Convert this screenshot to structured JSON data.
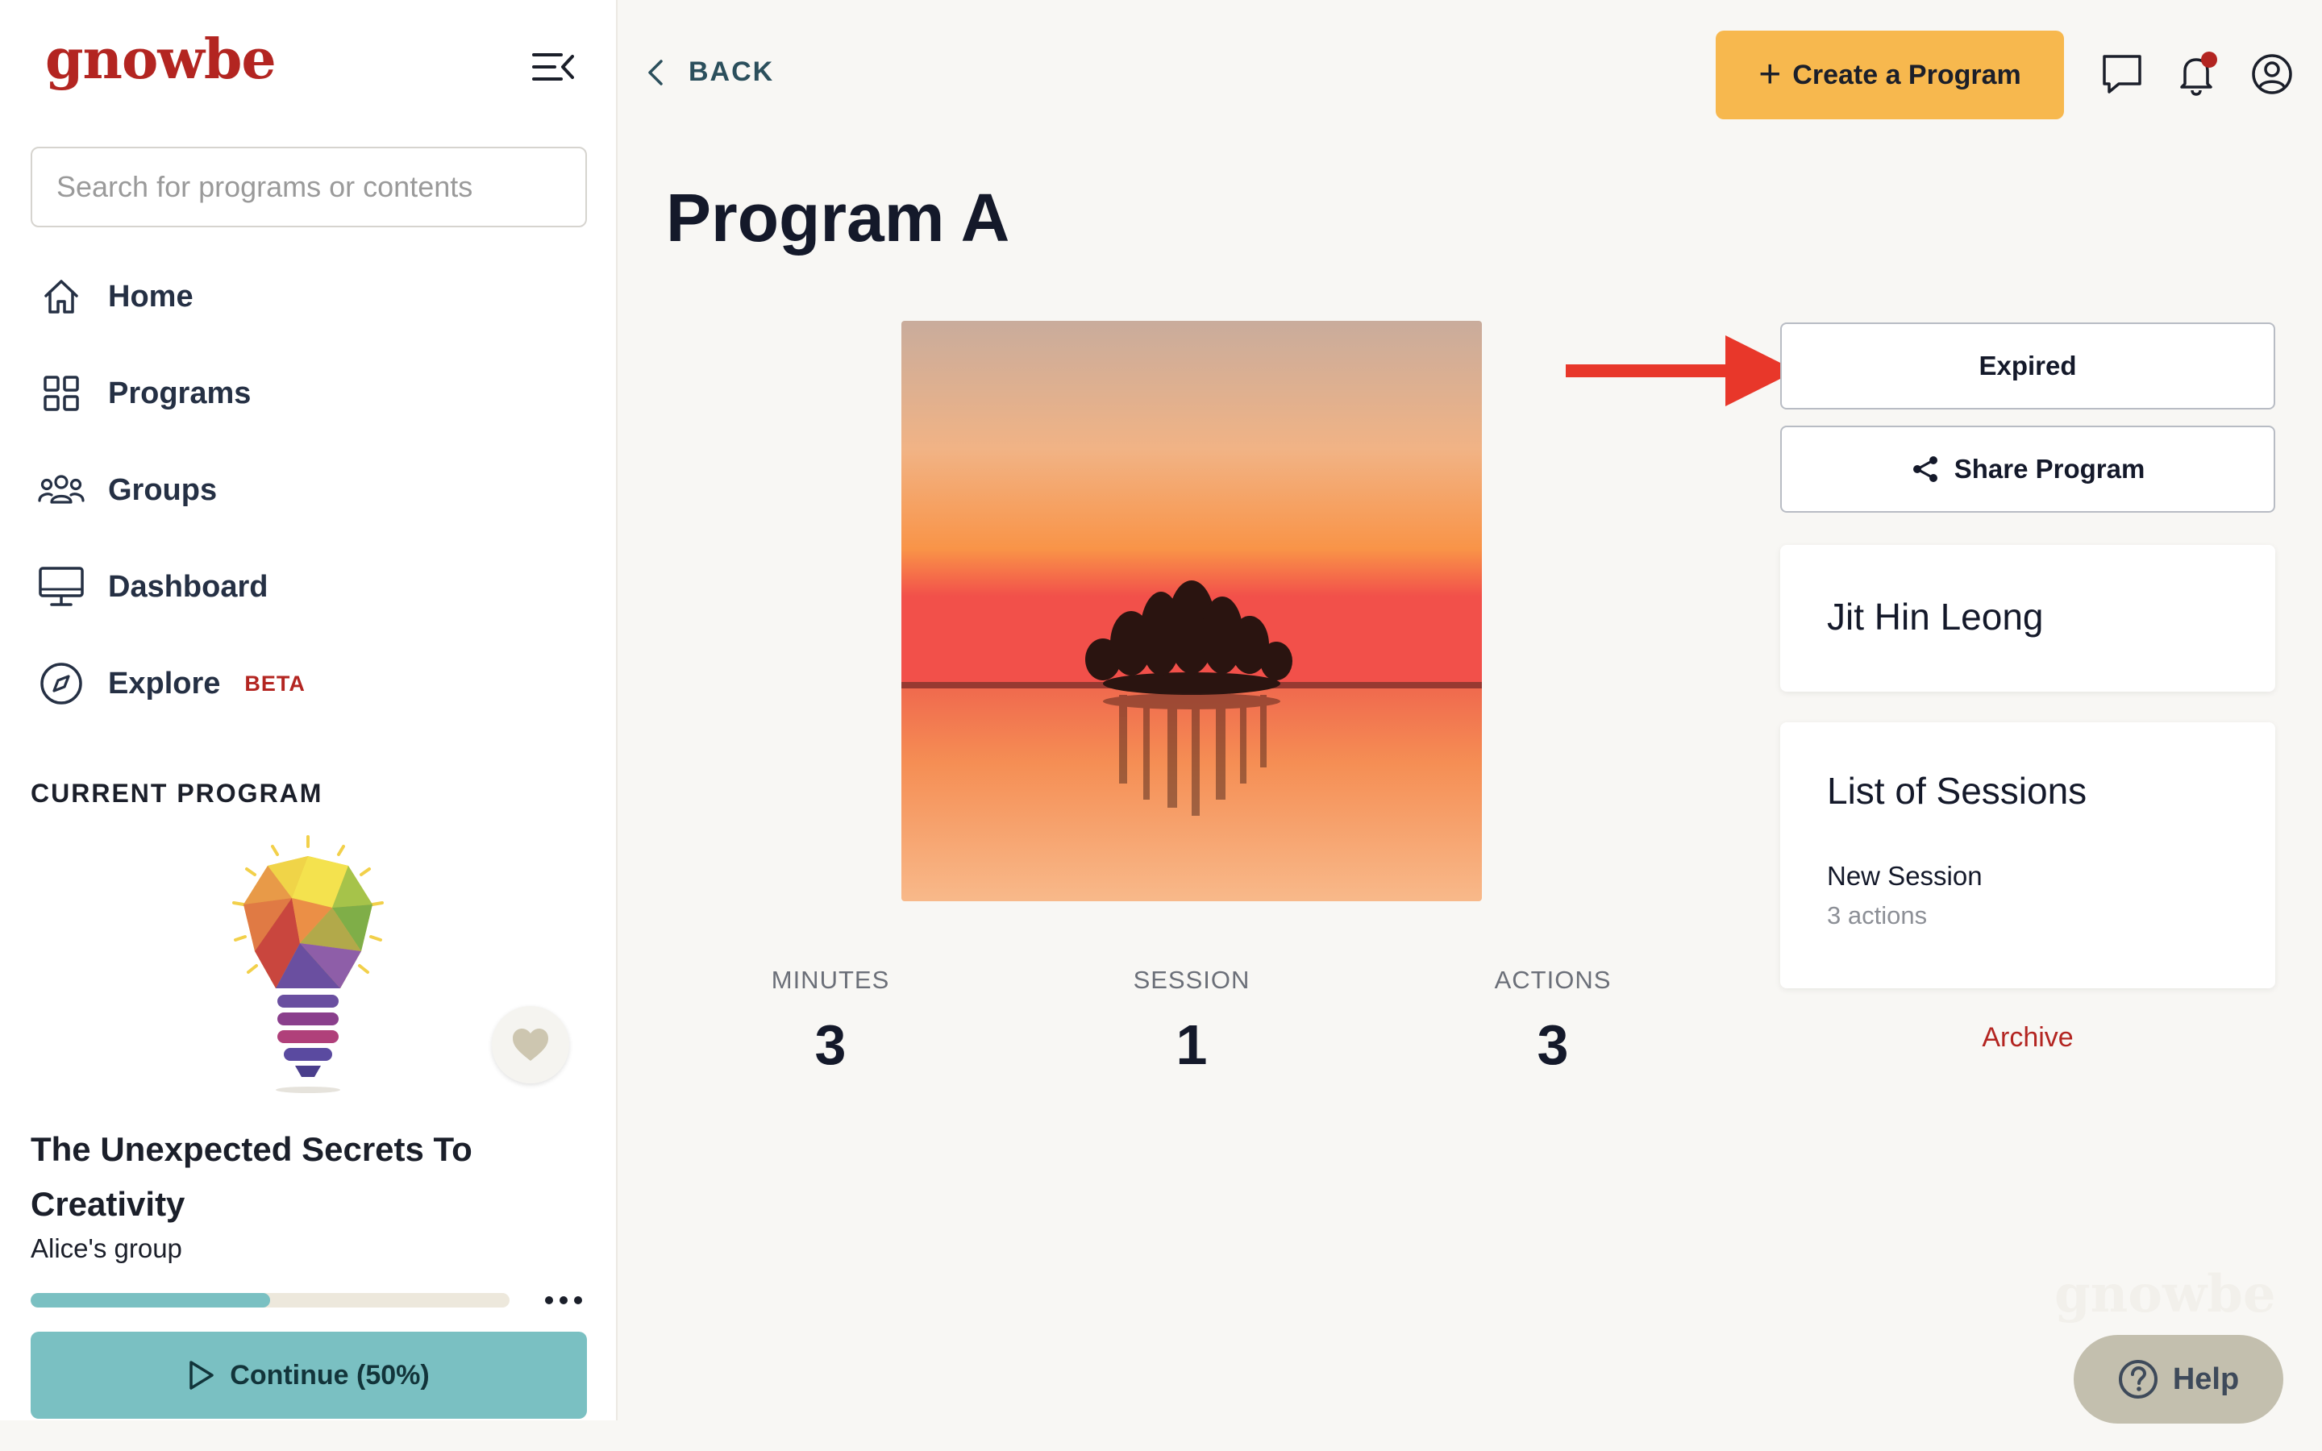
{
  "brand": {
    "logo_text": "gnowbe",
    "accent": "#b32521"
  },
  "sidebar": {
    "search_placeholder": "Search for programs or contents",
    "nav": [
      {
        "label": "Home",
        "icon": "home-icon"
      },
      {
        "label": "Programs",
        "icon": "grid-icon"
      },
      {
        "label": "Groups",
        "icon": "groups-icon"
      },
      {
        "label": "Dashboard",
        "icon": "monitor-icon"
      },
      {
        "label": "Explore",
        "icon": "compass-icon",
        "badge": "BETA"
      }
    ],
    "current_program": {
      "section_title": "CURRENT PROGRAM",
      "title": "The Unexpected Secrets To Creativity",
      "group": "Alice's group",
      "progress": 0.5,
      "continue_label": "Continue (50%)"
    }
  },
  "header": {
    "back_label": "BACK",
    "create_label": "Create a Program",
    "icons": [
      "chat-icon",
      "bell-icon",
      "user-icon"
    ]
  },
  "program": {
    "title": "Program A",
    "stats": [
      {
        "label": "MINUTES",
        "value": "3"
      },
      {
        "label": "SESSION",
        "value": "1"
      },
      {
        "label": "ACTIONS",
        "value": "3"
      }
    ],
    "status_label": "Expired",
    "share_label": "Share Program",
    "author": "Jit Hin Leong",
    "sessions_title": "List of Sessions",
    "sessions": [
      {
        "name": "New Session",
        "actions": "3 actions"
      }
    ],
    "archive_label": "Archive"
  },
  "footer": {
    "help_label": "Help",
    "watermark": "gnowbe"
  }
}
